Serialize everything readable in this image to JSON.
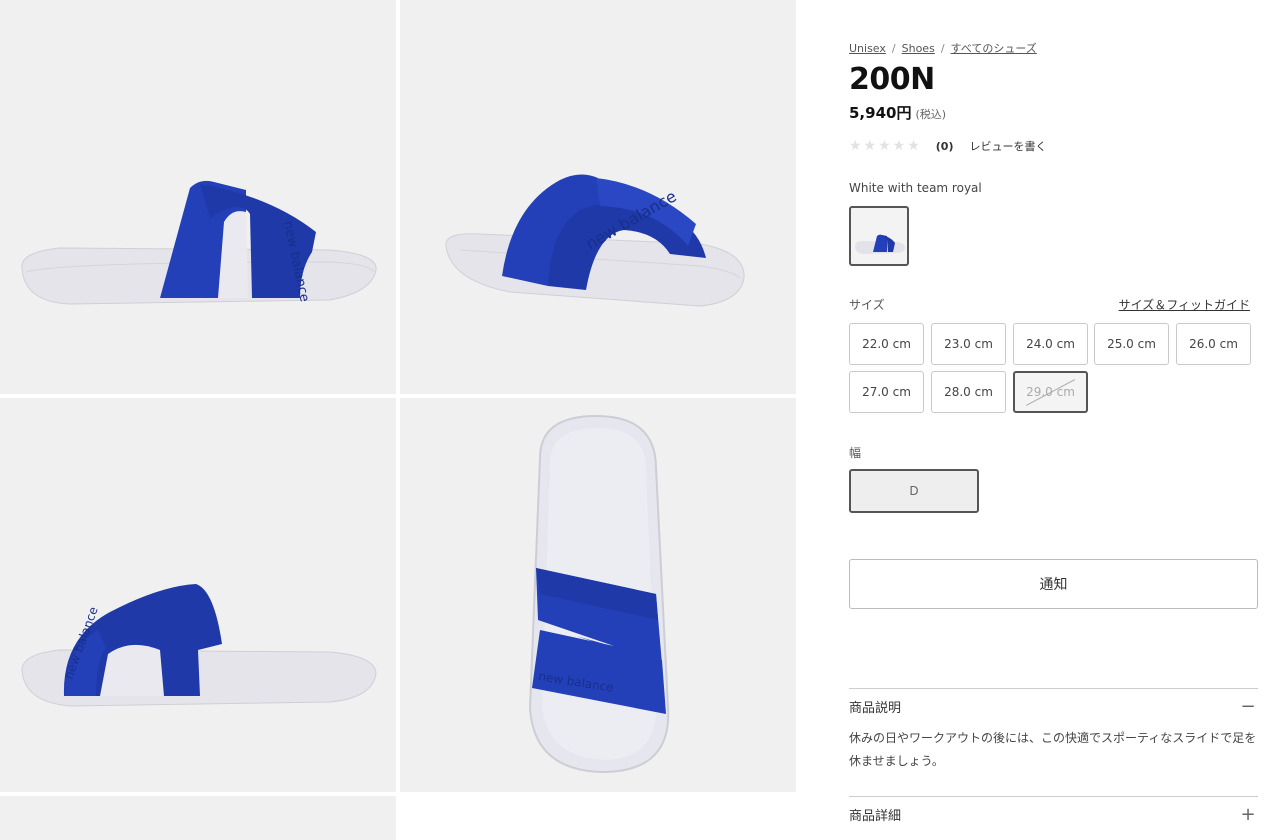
{
  "breadcrumb": [
    "Unisex",
    "Shoes",
    "すべてのシューズ"
  ],
  "product": {
    "name": "200N",
    "price": "5,940円",
    "tax_note": "(税込)",
    "rating_count": "(0)",
    "write_review": "レビューを書く",
    "color_name": "White with team royal"
  },
  "size": {
    "label": "サイズ",
    "guide": "サイズ＆フィットガイド",
    "options": [
      {
        "label": "22.0 cm",
        "available": true
      },
      {
        "label": "23.0 cm",
        "available": true
      },
      {
        "label": "24.0 cm",
        "available": true
      },
      {
        "label": "25.0 cm",
        "available": true
      },
      {
        "label": "26.0 cm",
        "available": true
      },
      {
        "label": "27.0 cm",
        "available": true
      },
      {
        "label": "28.0 cm",
        "available": true
      },
      {
        "label": "29.0 cm",
        "available": false
      }
    ]
  },
  "width": {
    "label": "幅",
    "selected": "D"
  },
  "notify_label": "通知",
  "accordion": [
    {
      "title": "商品説明",
      "icon": "minus-icon",
      "expanded": true,
      "body": "休みの日やワークアウトの後には、この快適でスポーティなスライドで足を休ませましょう。"
    },
    {
      "title": "商品詳細",
      "icon": "plus-icon",
      "expanded": false,
      "body": ""
    }
  ],
  "colors": {
    "royal": "#2340b8",
    "sole": "#e8e8ee",
    "tile_bg": "#f0f0f0"
  }
}
